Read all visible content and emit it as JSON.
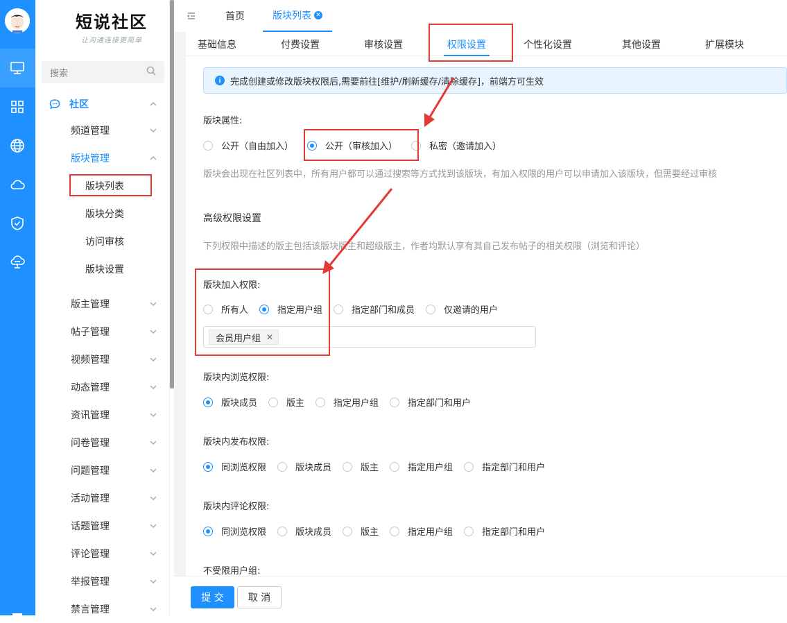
{
  "rail": {
    "icons": [
      "monitor-icon",
      "grid-icon",
      "globe-icon",
      "cloud-icon",
      "shield-check-icon",
      "cloud-network-icon"
    ]
  },
  "brand": {
    "title": "短说社区",
    "slogan": "让沟通连接更简单"
  },
  "sidebar": {
    "search_placeholder": "搜索",
    "section": "社区",
    "items": [
      {
        "label": "频道管理"
      },
      {
        "label": "版块管理"
      },
      {
        "label": "版块列表"
      },
      {
        "label": "版块分类"
      },
      {
        "label": "访问审核"
      },
      {
        "label": "版块设置"
      },
      {
        "label": "版主管理"
      },
      {
        "label": "帖子管理"
      },
      {
        "label": "视频管理"
      },
      {
        "label": "动态管理"
      },
      {
        "label": "资讯管理"
      },
      {
        "label": "问卷管理"
      },
      {
        "label": "问题管理"
      },
      {
        "label": "活动管理"
      },
      {
        "label": "话题管理"
      },
      {
        "label": "评论管理"
      },
      {
        "label": "举报管理"
      },
      {
        "label": "禁言管理"
      }
    ]
  },
  "tabs": {
    "home": "首页",
    "current": "版块列表"
  },
  "subtabs": [
    "基础信息",
    "付费设置",
    "审核设置",
    "权限设置",
    "个性化设置",
    "其他设置",
    "扩展模块"
  ],
  "notice": "完成创建或修改版块权限后,需要前往[维护/刷新缓存/清除缓存]，前端方可生效",
  "form": {
    "attr_label": "版块属性:",
    "attr_options": [
      "公开（自由加入）",
      "公开（审核加入）",
      "私密（邀请加入）"
    ],
    "attr_help": "版块会出现在社区列表中，所有用户都可以通过搜索等方式找到该版块，有加入权限的用户可以申请加入该版块，但需要经过审核",
    "adv_title": "高级权限设置",
    "adv_help": "下列权限中描述的版主包括该版块版主和超级版主，作者均默认享有其自己发布帖子的相关权限（浏览和评论）",
    "join_label": "版块加入权限:",
    "join_options": [
      "所有人",
      "指定用户组",
      "指定部门和成员",
      "仅邀请的用户"
    ],
    "join_tag": "会员用户组",
    "browse_label": "版块内浏览权限:",
    "browse_options": [
      "版块成员",
      "版主",
      "指定用户组",
      "指定部门和用户"
    ],
    "post_label": "版块内发布权限:",
    "post_options": [
      "同浏览权限",
      "版块成员",
      "版主",
      "指定用户组",
      "指定部门和用户"
    ],
    "comment_label": "版块内评论权限:",
    "comment_options": [
      "同浏览权限",
      "版块成员",
      "版主",
      "指定用户组",
      "指定部门和用户"
    ],
    "unlimited_label": "不受限用户组:"
  },
  "footer": {
    "submit": "提 交",
    "cancel": "取 消"
  },
  "colors": {
    "primary": "#1e90ff",
    "annotation": "#e53935"
  }
}
